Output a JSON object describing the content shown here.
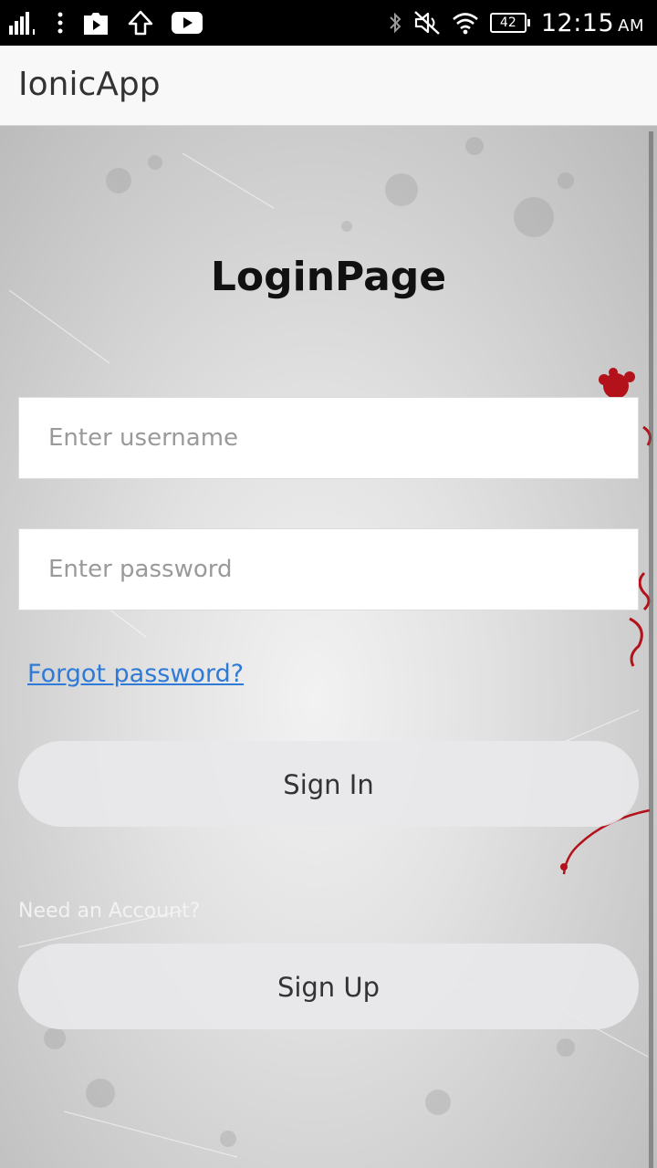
{
  "status_bar": {
    "battery": "42",
    "time": "12:15",
    "ampm": "AM",
    "icons": [
      "signal-icon",
      "more-vert-icon",
      "play-store-icon",
      "upload-icon",
      "youtube-icon",
      "bluetooth-icon",
      "mute-icon",
      "wifi-icon",
      "battery-icon"
    ]
  },
  "header": {
    "title": "IonicApp"
  },
  "login": {
    "heading": "LoginPage",
    "username_placeholder": "Enter username",
    "username_value": "",
    "password_placeholder": "Enter password",
    "password_value": "",
    "forgot_label": "Forgot password?",
    "signin_label": "Sign In",
    "need_account_label": "Need an Account?",
    "signup_label": "Sign Up"
  },
  "colors": {
    "link": "#2f7ad6",
    "header_bg": "#f8f8f8",
    "status_bar_bg": "#000000",
    "accent_flower": "#b3121a"
  }
}
